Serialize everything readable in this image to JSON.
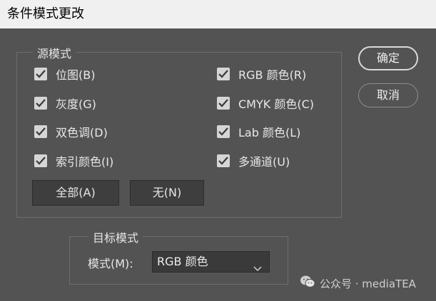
{
  "dialog": {
    "title": "条件模式更改",
    "ok_label": "确定",
    "cancel_label": "取消"
  },
  "source": {
    "legend": "源模式",
    "modes": [
      {
        "label": "位图(B)",
        "checked": true
      },
      {
        "label": "灰度(G)",
        "checked": true
      },
      {
        "label": "双色调(D)",
        "checked": true
      },
      {
        "label": "索引颜色(I)",
        "checked": true
      },
      {
        "label": "RGB 颜色(R)",
        "checked": true
      },
      {
        "label": "CMYK 颜色(C)",
        "checked": true
      },
      {
        "label": "Lab 颜色(L)",
        "checked": true
      },
      {
        "label": "多通道(U)",
        "checked": true
      }
    ],
    "all_label": "全部(A)",
    "none_label": "无(N)"
  },
  "target": {
    "legend": "目标模式",
    "mode_label": "模式(M):",
    "mode_value": "RGB 颜色"
  },
  "watermark": {
    "text": "公众号 · mediaTEA",
    "icon": "wechat-icon"
  },
  "colors": {
    "background": "#535353",
    "titlebar": "#f0f0f0",
    "checkbox": "#d6d6d6"
  }
}
